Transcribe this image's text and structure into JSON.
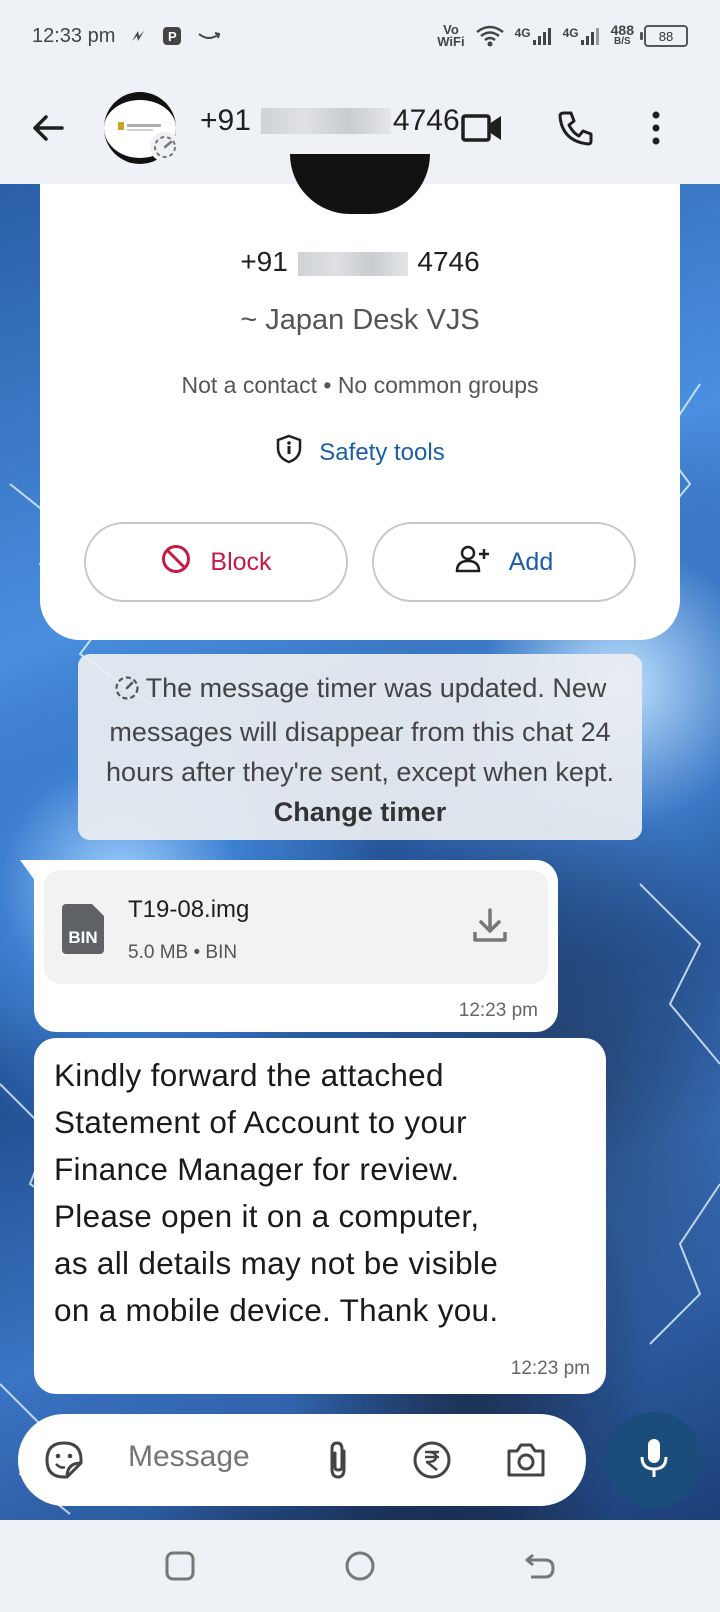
{
  "status_bar": {
    "time": "12:33 pm",
    "vowifi_top": "Vo",
    "vowifi_bottom": "WiFi",
    "net1": "4G",
    "net2": "4G",
    "speed_value": "488",
    "speed_unit": "B/S",
    "battery": "88"
  },
  "header": {
    "phone_prefix": "+91",
    "phone_suffix": "4746",
    "icons": [
      "back-arrow-icon",
      "video-call-icon",
      "voice-call-icon",
      "more-options-icon"
    ]
  },
  "info_card": {
    "phone_prefix": "+91",
    "phone_suffix": "4746",
    "name": "~ Japan Desk VJS",
    "subtitle": "Not a contact • No common groups",
    "safety_tools_label": "Safety tools",
    "block_label": "Block",
    "add_label": "Add"
  },
  "system_message": {
    "text": "The message timer was updated. New messages will disappear from this chat 24 hours after they're sent, except when kept.",
    "link": "Change timer"
  },
  "messages": [
    {
      "type": "file",
      "file_name": "T19-08.img",
      "file_meta": "5.0 MB • BIN",
      "file_type_label": "BIN",
      "time": "12:23 pm"
    },
    {
      "type": "text",
      "lines": [
        "Kindly forward the attached",
        "Statement of Account to your",
        "Finance Manager for review.",
        "Please open it on a computer,",
        "as all details may not be visible",
        "on a mobile device. Thank you."
      ],
      "time": "12:23 pm"
    }
  ],
  "composer": {
    "placeholder": "Message"
  },
  "colors": {
    "accent_blue": "#1b5ea6",
    "block_red": "#c51c45",
    "mic_button": "#1a4d7a"
  }
}
